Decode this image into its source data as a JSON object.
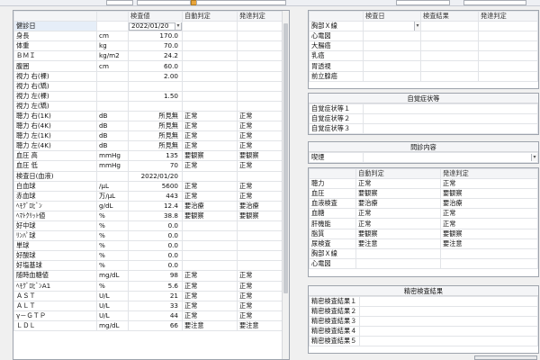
{
  "header": {
    "date_field": "2022/01/20"
  },
  "main_table": {
    "headers": [
      "",
      "",
      "検査値",
      "自動判定",
      "発達判定"
    ],
    "rows": [
      [
        "健診日",
        "",
        "2022/01/20",
        "",
        ""
      ],
      [
        "身長",
        "cm",
        "170.0",
        "",
        ""
      ],
      [
        "体重",
        "kg",
        "70.0",
        "",
        ""
      ],
      [
        "ＢＭＩ",
        "kg/m2",
        "24.2",
        "",
        ""
      ],
      [
        "腹囲",
        "cm",
        "60.0",
        "",
        ""
      ],
      [
        "視力 右(裸)",
        "",
        "2.00",
        "",
        ""
      ],
      [
        "視力 右(矯)",
        "",
        "",
        "",
        ""
      ],
      [
        "視力 左(裸)",
        "",
        "1.50",
        "",
        ""
      ],
      [
        "視力 左(矯)",
        "",
        "",
        "",
        ""
      ],
      [
        "聴力 右(1K)",
        "dB",
        "所見無",
        "正常",
        "正常"
      ],
      [
        "聴力 右(4K)",
        "dB",
        "所見無",
        "正常",
        "正常"
      ],
      [
        "聴力 左(1K)",
        "dB",
        "所見無",
        "正常",
        "正常"
      ],
      [
        "聴力 左(4K)",
        "dB",
        "所見無",
        "正常",
        "正常"
      ],
      [
        "血圧 高",
        "mmHg",
        "135",
        "要観察",
        "要観察"
      ],
      [
        "血圧 低",
        "mmHg",
        "70",
        "正常",
        "正常"
      ],
      [
        "検査日(血液)",
        "",
        "2022/01/20",
        "",
        ""
      ],
      [
        "白血球",
        "/μL",
        "5600",
        "正常",
        "正常"
      ],
      [
        "赤血球",
        "万/μL",
        "443",
        "正常",
        "正常"
      ],
      [
        "ﾍﾓｸﾞﾛﾋﾞﾝ",
        "g/dL",
        "12.4",
        "要治療",
        "要治療"
      ],
      [
        "ﾍﾏﾄｸﾘｯﾄ値",
        "%",
        "38.8",
        "要観察",
        "要観察"
      ],
      [
        "好中球",
        "%",
        "0.0",
        "",
        ""
      ],
      [
        "ﾘﾝﾊﾟ球",
        "%",
        "0.0",
        "",
        ""
      ],
      [
        "単球",
        "%",
        "0.0",
        "",
        ""
      ],
      [
        "好酸球",
        "%",
        "0.0",
        "",
        ""
      ],
      [
        "好塩基球",
        "%",
        "0.0",
        "",
        ""
      ],
      [
        "随時血糖値",
        "mg/dL",
        "98",
        "正常",
        "正常"
      ],
      [
        "ﾍﾓｸﾞﾛﾋﾞﾝA1",
        "%",
        "5.6",
        "正常",
        "正常"
      ],
      [
        "ＡＳＴ",
        "U/L",
        "21",
        "正常",
        "正常"
      ],
      [
        "ＡＬＴ",
        "U/L",
        "33",
        "正常",
        "正常"
      ],
      [
        "γ－ＧＴＰ",
        "U/L",
        "44",
        "正常",
        "正常"
      ],
      [
        "ＬＤＬ",
        "mg/dL",
        "66",
        "要注意",
        "要注意"
      ]
    ]
  },
  "exam_panel": {
    "headers": [
      "",
      "検査日",
      "検査結果",
      "発達判定"
    ],
    "rows": [
      "胸部Ｘ線",
      "心電図",
      "大腸癌",
      "乳癌",
      "胃透視",
      "前立腺癌"
    ]
  },
  "symptom_panel": {
    "caption": "自覚症状等",
    "rows": [
      "自覚症状等１",
      "自覚症状等２",
      "自覚症状等３"
    ]
  },
  "consult_panel": {
    "caption": "問診内容",
    "row_label": "喫煙"
  },
  "judge_panel": {
    "headers": [
      "",
      "自動判定",
      "発達判定"
    ],
    "rows": [
      [
        "聴力",
        "正常",
        "正常"
      ],
      [
        "血圧",
        "要観察",
        "要観察"
      ],
      [
        "血液検査",
        "要治療",
        "要治療"
      ],
      [
        "血糖",
        "正常",
        "正常"
      ],
      [
        "肝機能",
        "正常",
        "正常"
      ],
      [
        "脂質",
        "要観察",
        "要観察"
      ],
      [
        "尿検査",
        "要注意",
        "要注意"
      ],
      [
        "胸部Ｘ線",
        "",
        ""
      ],
      [
        "心電図",
        "",
        ""
      ]
    ]
  },
  "detail_panel": {
    "caption": "精密検査結果",
    "rows": [
      "精密検査結果１",
      "精密検査結果２",
      "精密検査結果３",
      "精密検査結果４",
      "精密検査結果５"
    ]
  }
}
